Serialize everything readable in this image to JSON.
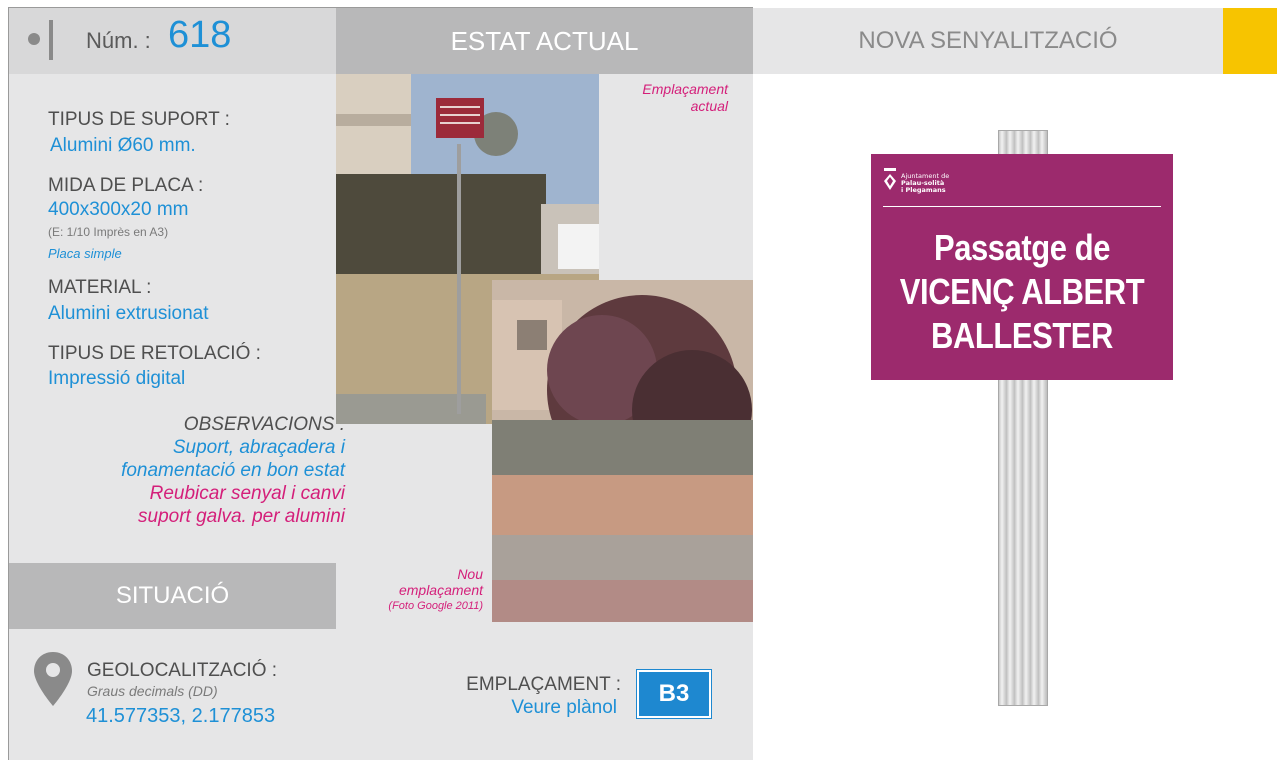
{
  "header": {
    "num_label": "Núm. :",
    "num_value": "618",
    "estat_actual": "ESTAT ACTUAL",
    "nova_senyalitzacio": "NOVA SENYALITZACIÓ"
  },
  "specs": {
    "tipus_suport_label": "TIPUS DE SUPORT :",
    "tipus_suport_value": "Alumini Ø60 mm.",
    "mida_placa_label": "MIDA DE PLACA :",
    "mida_placa_value": "400x300x20 mm",
    "mida_placa_note": "(E: 1/10 Imprès en A3)",
    "mida_placa_type": "Placa simple",
    "material_label": "MATERIAL :",
    "material_value": "Alumini extrusionat",
    "retolacio_label": "TIPUS DE RETOLACIÓ :",
    "retolacio_value": "Impressió digital"
  },
  "observations": {
    "label": "OBSERVACIONS :",
    "line1": "Suport, abraçadera i",
    "line2": "fonamentació en bon estat",
    "line3": "Reubicar senyal i canvi",
    "line4": "suport galva. per alumini"
  },
  "situacio": {
    "title": "SITUACIÓ",
    "geo_label": "GEOLOCALITZACIÓ :",
    "geo_format": "Graus decimals (DD)",
    "geo_value": "41.577353, 2.177853"
  },
  "photos": {
    "caption1_line1": "Emplaçament",
    "caption1_line2": "actual",
    "caption2_line1": "Nou",
    "caption2_line2": "emplaçament",
    "caption2_line3": "(Foto Google 2011)"
  },
  "emplacament": {
    "label": "EMPLAÇAMENT :",
    "link": "Veure plànol",
    "code": "B3"
  },
  "sign": {
    "logo_line1": "Ajuntament de",
    "logo_line2": "Palau-solità",
    "logo_line3": "i Plegamans",
    "line1": "Passatge de",
    "line2": "VICENÇ ALBERT",
    "line3": "BALLESTER"
  },
  "colors": {
    "accent_blue": "#1e90d6",
    "accent_magenta": "#d41f7a",
    "sign_purple": "#9c2a6d",
    "corner_yellow": "#f7c400"
  }
}
